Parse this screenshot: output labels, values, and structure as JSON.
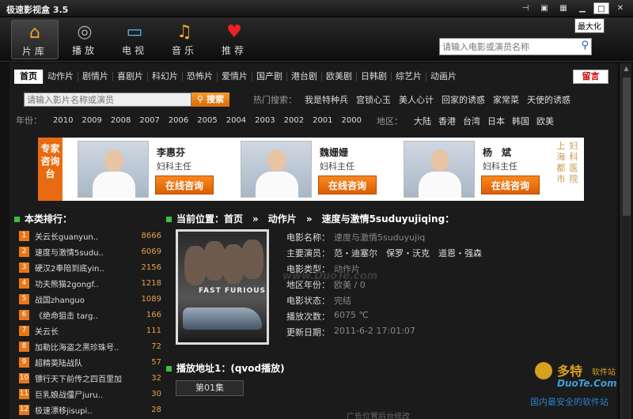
{
  "window": {
    "title": "极速影视盒 3.5",
    "tooltip": "最大化"
  },
  "nav": {
    "items": [
      {
        "label": "片库",
        "icon": "house-icon",
        "glyph": "⌂"
      },
      {
        "label": "播放",
        "icon": "film-reel-icon",
        "glyph": "◎"
      },
      {
        "label": "电视",
        "icon": "monitor-icon",
        "glyph": "▭"
      },
      {
        "label": "音乐",
        "icon": "music-note-icon",
        "glyph": "♫"
      },
      {
        "label": "推荐",
        "icon": "heart-icon",
        "glyph": "♥"
      }
    ],
    "search_placeholder": "请输入电影或演员名称"
  },
  "categories": [
    "首页",
    "动作片",
    "剧情片",
    "喜剧片",
    "科幻片",
    "恐怖片",
    "爱情片",
    "国产剧",
    "港台剧",
    "欧美剧",
    "日韩剧",
    "综艺片",
    "动画片"
  ],
  "message_button": "留言",
  "filter": {
    "placeholder": "请输入影片名称或演员",
    "search_button": "搜索",
    "hot_label": "热门搜索：",
    "hot_keywords": [
      "我是特种兵",
      "宫锁心玉",
      "美人心计",
      "回家的诱惑",
      "家常菜",
      "天使的诱惑"
    ]
  },
  "years": {
    "label": "年份：",
    "items": [
      "2010",
      "2009",
      "2008",
      "2007",
      "2006",
      "2005",
      "2004",
      "2003",
      "2002",
      "2001",
      "2000"
    ]
  },
  "regions": {
    "label": "地区：",
    "items": [
      "大陆",
      "香港",
      "台湾",
      "日本",
      "韩国",
      "欧美"
    ]
  },
  "banner": {
    "side_text": "专家咨询台",
    "doctors": [
      {
        "name": "李惠芬",
        "role": "妇科主任",
        "button": "在线咨询"
      },
      {
        "name": "魏姗姗",
        "role": "妇科主任",
        "button": "在线咨询"
      },
      {
        "name": "杨　斌",
        "role": "妇科主任",
        "button": "在线咨询"
      }
    ],
    "right_text_1": "上海都市",
    "right_text_2": "妇科医院"
  },
  "ranking": {
    "title": "本类排行：",
    "items": [
      {
        "num": "1",
        "name": "关云长guanyun..",
        "count": "8666"
      },
      {
        "num": "2",
        "name": "速度与激情5sudu..",
        "count": "6069"
      },
      {
        "num": "3",
        "name": "硬汉2奉陪到底yin..",
        "count": "2156"
      },
      {
        "num": "4",
        "name": "功夫熊猫2gongf..",
        "count": "1218"
      },
      {
        "num": "5",
        "name": "战国zhanguo",
        "count": "1089"
      },
      {
        "num": "6",
        "name": "《绝命狙击 targ..",
        "count": "166"
      },
      {
        "num": "7",
        "name": "关云长",
        "count": "111"
      },
      {
        "num": "8",
        "name": "加勒比海盗之黑珍珠号..",
        "count": "72"
      },
      {
        "num": "9",
        "name": "超精英陆战队",
        "count": "57"
      },
      {
        "num": "10",
        "name": "镖行天下前传之四百里加",
        "count": "32"
      },
      {
        "num": "11",
        "name": "巨乳娘战僵尸juru..",
        "count": "30"
      },
      {
        "num": "12",
        "name": "极速漂移jisupi..",
        "count": "28"
      }
    ]
  },
  "detail": {
    "crumb_label": "当前位置：",
    "crumb_home": "首页",
    "crumb_sep": "»",
    "crumb_category": "动作片",
    "crumb_title": "速度与激情5suduyujiqing：",
    "poster_text": "FAST FURIOUS",
    "fields": [
      {
        "k": "电影名称：",
        "v": "速度与激情5suduyujiq",
        "bright": false
      },
      {
        "k": "主要演员：",
        "v": "范・迪塞尔　保罗・沃克　道恩・强森",
        "bright": true
      },
      {
        "k": "电影类型：",
        "v": "动作片",
        "bright": false
      },
      {
        "k": "地区年份：",
        "v": "欧美 / 0",
        "bright": false
      },
      {
        "k": "电影状态：",
        "v": "完结",
        "bright": false
      },
      {
        "k": "播放次数：",
        "v": "6075 ℃",
        "bright": false
      },
      {
        "k": "更新日期：",
        "v": "2011-6-2 17:01:07",
        "bright": false
      }
    ],
    "play_title": "播放地址1：(qvod播放)",
    "episode": "第01集",
    "ad_text": "广告位置后台修改"
  },
  "watermark": {
    "center": "www.DuoTe.com",
    "brand": "多特",
    "brand_small": "软件站",
    "site": "DuoTe.Com",
    "tagline": "国内最安全的软件站"
  }
}
